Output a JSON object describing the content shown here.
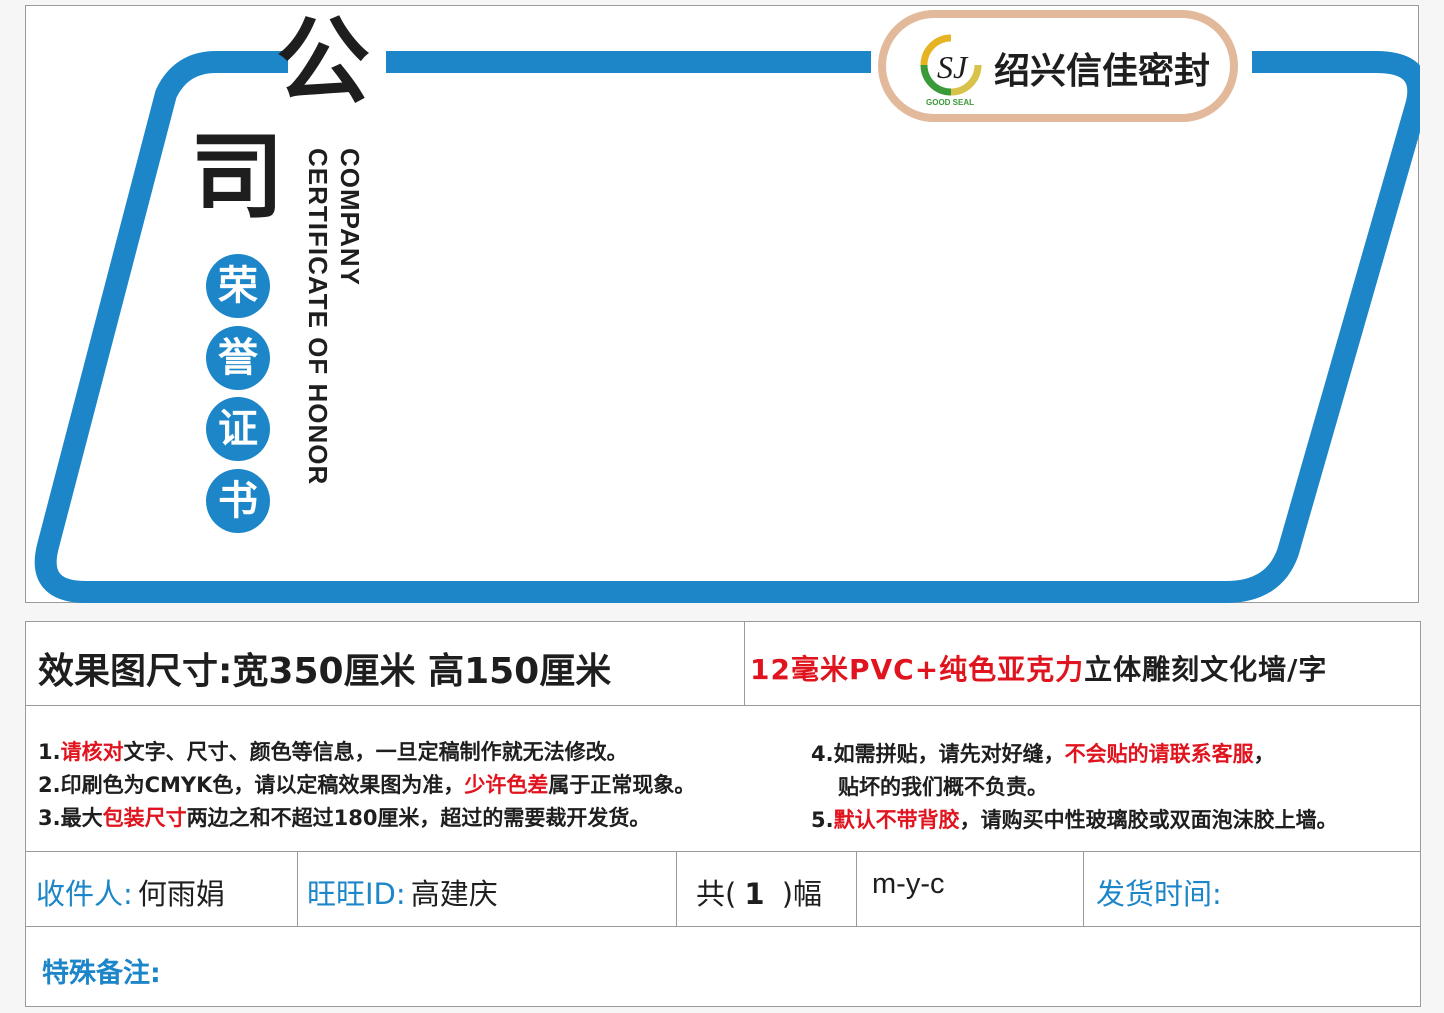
{
  "design": {
    "title_char_1": "公",
    "title_char_2": "司",
    "circle_chars": [
      "荣",
      "誉",
      "证",
      "书"
    ],
    "english_line_1": "COMPANY",
    "english_line_2": "CERTIFICATE OF HONOR",
    "logo": {
      "brand": "绍兴信佳密封",
      "mark_letters": "SJ",
      "tagline": "GOOD SEAL"
    },
    "colors": {
      "frame_blue": "#1c86c8",
      "logo_border": "#e2b99b",
      "text_dark": "#1e1e1e"
    }
  },
  "spec": {
    "size": "效果图尺寸:宽350厘米  高150厘米",
    "material_red": "12毫米PVC+纯色亚克力",
    "material_rest": "立体雕刻文化墙/字"
  },
  "notes": {
    "n1_pre": "1.",
    "n1_red": "请核对",
    "n1_post": "文字、尺寸、颜色等信息，一旦定稿制作就无法修改。",
    "n2_pre": "2.印刷色为CMYK色，请以定稿效果图为准，",
    "n2_red": "少许色差",
    "n2_post": "属于正常现象。",
    "n3_pre": "3.最大",
    "n3_red": "包装尺寸",
    "n3_post": "两边之和不超过180厘米，超过的需要裁开发货。",
    "n4_pre": "4.如需拼贴，请先对好缝，",
    "n4_red": "不会贴的请联系客服",
    "n4_post": "，",
    "n4_cont": "贴坏的我们概不负责。",
    "n5_pre": "5.",
    "n5_red": "默认不带背胶",
    "n5_post": "，请购买中性玻璃胶或双面泡沫胶上墙。"
  },
  "order": {
    "recipient_label": "收件人:",
    "recipient_value": "何雨娟",
    "wangwang_label": "旺旺ID:",
    "wangwang_value": "高建庆",
    "count_pre": "共(",
    "count_value": "1",
    "count_post": " )幅",
    "color_code": "m-y-c",
    "ship_time_label": "发货时间:",
    "ship_time_value": "",
    "remarks_label": "特殊备注:",
    "remarks_value": ""
  }
}
